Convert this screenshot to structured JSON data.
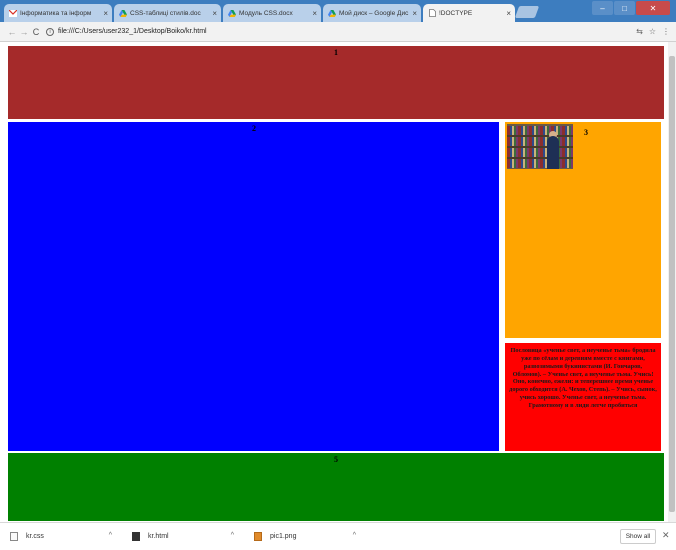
{
  "browser": {
    "tabs": [
      {
        "title": "Інформатика та інформ",
        "icon": "gmail-icon",
        "active": false
      },
      {
        "title": "CSS-таблиці стилів.doc",
        "icon": "google-drive-icon",
        "active": false
      },
      {
        "title": "Модуль CSS.docx",
        "icon": "google-drive-icon",
        "active": false
      },
      {
        "title": "Мой диск – Google Дис",
        "icon": "google-drive-icon",
        "active": false
      },
      {
        "title": "!DOCTYPE",
        "icon": "page-icon",
        "active": true
      }
    ],
    "url": "file:///C:/Users/user232_1/Desktop/Boiko/kr.html"
  },
  "page": {
    "block1": "1",
    "block2": "2",
    "block3": "3",
    "block5": "5",
    "quote": "Пословица «ученье свет, а неученье тьма» бродила уже по сёлам и деревням вместе с книгами, развозимыми букинистами (И. Гончаров, Обломов). – Ученье свет, а неученье тьма. Учись! Оно, конечно, ежели: и теперешнее время ученье дорого обходится (А. Чехов, Степь). – Учись, сынок, учись хорошо. Ученье свет, а неученье тьма. Грамотному и в лиди легче пробиться",
    "colors": {
      "block1": "#a52a2a",
      "block2": "#0000ff",
      "block3": "#ffa500",
      "block4": "#ff0000",
      "block5": "#008000"
    }
  },
  "downloads": {
    "items": [
      {
        "name": "kr.css",
        "icon": "css-file-icon"
      },
      {
        "name": "kr.html",
        "icon": "html-file-icon"
      },
      {
        "name": "pic1.png",
        "icon": "png-file-icon"
      }
    ],
    "show_all": "Show all"
  }
}
